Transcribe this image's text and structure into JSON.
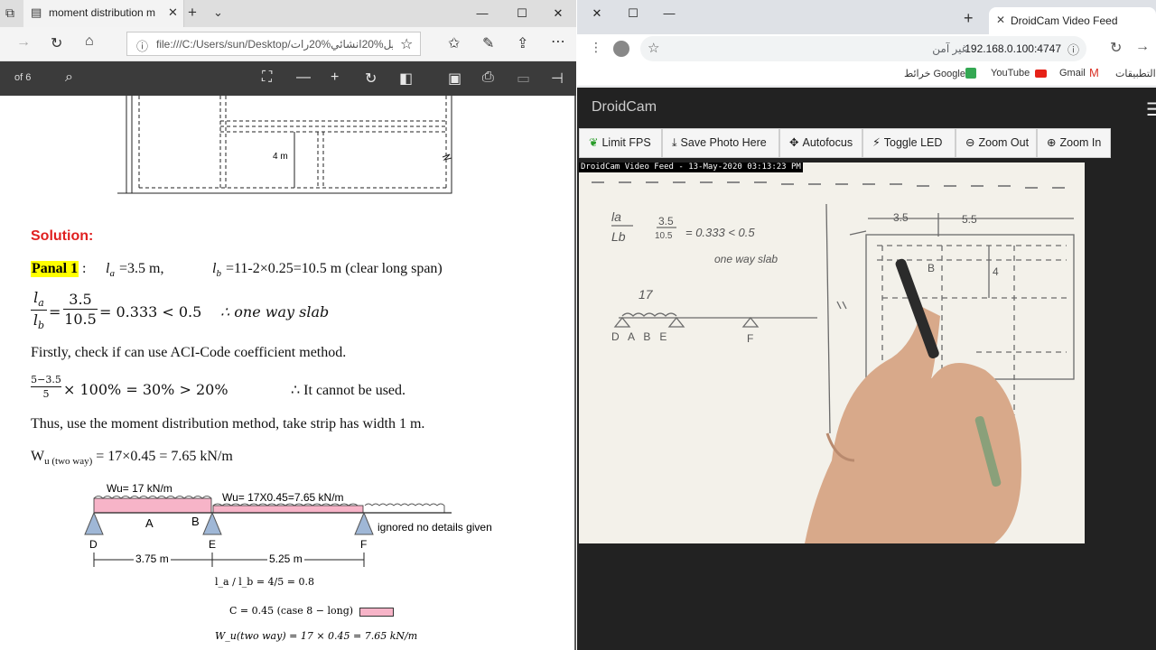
{
  "edge": {
    "tab_title": "moment distribution m",
    "address": "file:///C:/Users/sun/Desktop/تحليل%20انشائي%20رات",
    "pdf_page_indicator": "of 6"
  },
  "document": {
    "fig_dim_label": "4 m",
    "solution_heading": "Solution:",
    "panel_label": "Panal 1",
    "panel_colon": ":",
    "la_text": "l",
    "la_sub": "a",
    "la_value": "=3.5 m,",
    "lb_text": "l",
    "lb_sub": "b",
    "lb_value": "=11-2×0.25=10.5 m (clear long span)",
    "ratio_num": "3.5",
    "ratio_den": "10.5",
    "ratio_result": "= 0.333 < 0.5",
    "one_way": "∴ one way slab",
    "check_text": "Firstly, check if can use ACI-Code coefficient method.",
    "pct_num": "5−3.5",
    "pct_den": "5",
    "pct_result": "× 100% = 30% > 20%",
    "cannot": "∴ It cannot be used.",
    "thus_text": "Thus, use the moment distribution method, take strip has width 1 m.",
    "wu_label": "W",
    "wu_sub": "u (two way)",
    "wu_value": "= 17×0.45 = 7.65 kN/m",
    "beam": {
      "load1": "Wu= 17 kN/m",
      "load2": "Wu= 17X0.45=7.65 kN/m",
      "pt_a": "A",
      "pt_b": "B",
      "sup_d": "D",
      "sup_e": "E",
      "sup_f": "F",
      "ignored": "ignored no details given",
      "span1": "3.75 m",
      "span2": "5.25 m"
    },
    "ratio2": "l_a / l_b = 4/5 = 0.8",
    "coef": "C = 0.45 (case 8 − long)",
    "wu2": "W_u(two way) = 17 × 0.45 = 7.65 kN/m"
  },
  "chrome": {
    "tab_title": "DroidCam Video Feed",
    "url": "192.168.0.100:4747",
    "not_secure": "غير آمن",
    "bookmarks": [
      "التطبيقات",
      "Gmail",
      "YouTube",
      "خرائط Google"
    ]
  },
  "droidcam": {
    "brand": "DroidCam",
    "buttons": [
      {
        "label": "Limit FPS",
        "icon": "leaf-icon"
      },
      {
        "label": "Save Photo Here",
        "icon": "download-icon"
      },
      {
        "label": "Autofocus",
        "icon": "move-icon"
      },
      {
        "label": "Toggle LED",
        "icon": "bolt-icon"
      },
      {
        "label": "Zoom Out",
        "icon": "zoom-out-icon"
      },
      {
        "label": "Zoom In",
        "icon": "zoom-in-icon"
      }
    ],
    "feed_caption": "DroidCam Video Feed - 13-May-2020 03:13:23 PM",
    "handwriting": {
      "ratio_top": "la",
      "ratio_bottom": "Lb",
      "frac_num": "3.5",
      "frac_den": "10.5",
      "result": "= 0.333 < 0.5",
      "one_way": "one way slab",
      "load": "17",
      "pts": "D   A   B   E",
      "pt_f": "F",
      "dim1": "3.5",
      "dim2": "5.5",
      "dim3": "4",
      "lbl_b": "B"
    }
  }
}
